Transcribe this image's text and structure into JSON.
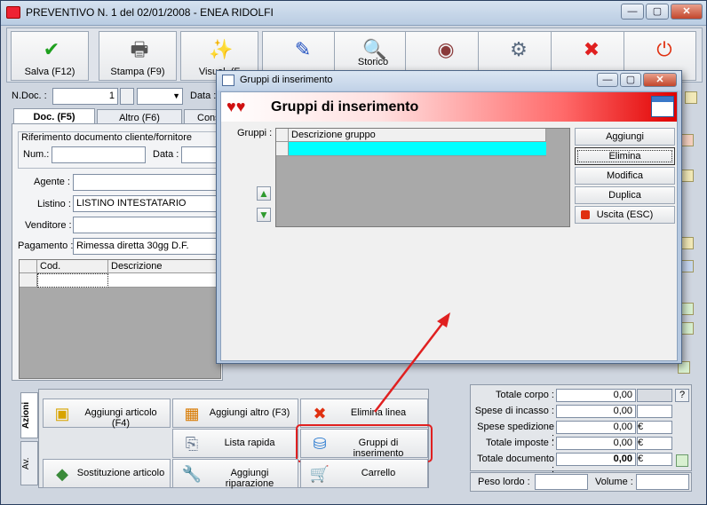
{
  "window": {
    "title": "PREVENTIVO N. 1  del 02/01/2008 - ENEA RIDOLFI",
    "min_glyph": "—",
    "max_glyph": "▢",
    "close_glyph": "✕"
  },
  "toolbar": {
    "buttons": [
      {
        "label": "Salva (F12)",
        "icon": "✔",
        "color": "#1ea01e"
      },
      {
        "label": "Stampa (F9)",
        "icon": "🖶",
        "color": "#555555"
      },
      {
        "label": "Visual. (F",
        "icon": "✨",
        "color": "#c98a00"
      },
      {
        "label": "",
        "icon": "✎",
        "color": "#2050c0"
      },
      {
        "label": "Storico",
        "icon": "🔍",
        "color": "#3a6ab0"
      },
      {
        "label": "",
        "icon": "◉",
        "color": "#8a3a3a"
      },
      {
        "label": "",
        "icon": "⚙",
        "color": "#5a6b80"
      },
      {
        "label": "",
        "icon": "✖",
        "color": "#e02020"
      },
      {
        "label": "",
        "icon": "⏻",
        "color": "#e03010"
      }
    ]
  },
  "header": {
    "ndoc_label": "N.Doc. :",
    "ndoc_value": "1",
    "data_label": "Data :"
  },
  "tabs": {
    "doc": "Doc. (F5)",
    "altro": "Altro (F6)",
    "cons": "Cons"
  },
  "doc": {
    "riferimento_label": "Riferimento documento cliente/fornitore",
    "num_label": "Num.:",
    "data_label": "Data :",
    "agente_label": "Agente :",
    "listino_label": "Listino :",
    "listino_value": "LISTINO INTESTATARIO",
    "venditore_label": "Venditore :",
    "pagamento_label": "Pagamento :",
    "pagamento_value": "Rimessa diretta 30gg D.F."
  },
  "grid": {
    "col_cod": "Cod.",
    "col_descrizione": "Descrizione"
  },
  "actions": {
    "tab_azioni": "Azioni",
    "tab_av": "Av.",
    "buttons": [
      {
        "label": "Aggiungi articolo (F4)",
        "icon": "▣",
        "color": "#d8a400"
      },
      {
        "label": "Aggiungi altro (F3)",
        "icon": "▦",
        "color": "#d87a00"
      },
      {
        "label": "Elimina linea",
        "icon": "✖",
        "color": "#e03010"
      },
      {
        "label": "Lista rapida",
        "icon": "⎘",
        "color": "#6a7a90"
      },
      {
        "label": "Gruppi di inserimento",
        "icon": "⛁",
        "color": "#2a7ad0"
      },
      {
        "label": "Sostituzione articolo",
        "icon": "◆",
        "color": "#3a8a3a"
      },
      {
        "label": "Aggiungi riparazione",
        "icon": "🔧",
        "color": "#707070"
      },
      {
        "label": "Carrello",
        "icon": "🛒",
        "color": "#707070"
      }
    ]
  },
  "totals": {
    "rows": [
      {
        "label": "Totale corpo :",
        "value": "0,00",
        "unit": ""
      },
      {
        "label": "Spese di incasso :",
        "value": "0,00",
        "unit": ""
      },
      {
        "label": "Spese spedizione :",
        "value": "0,00",
        "unit": "€"
      },
      {
        "label": "Totale imposte :",
        "value": "0,00",
        "unit": "€"
      },
      {
        "label": "Totale documento :",
        "value": "0,00",
        "unit": "€"
      }
    ],
    "help": "?",
    "peso_label": "Peso lordo :",
    "volume_label": "Volume :"
  },
  "dialog": {
    "title": "Gruppi di inserimento",
    "banner_title": "Gruppi di inserimento",
    "gruppi_label": "Gruppi :",
    "col_descrizione": "Descrizione gruppo",
    "buttons": {
      "aggiungi": "Aggiungi",
      "elimina": "Elimina",
      "modifica": "Modifica",
      "duplica": "Duplica",
      "uscita": "Uscita (ESC)"
    }
  },
  "colors": {
    "highlight_red": "#e02020",
    "selected_row": "#00ffff"
  }
}
